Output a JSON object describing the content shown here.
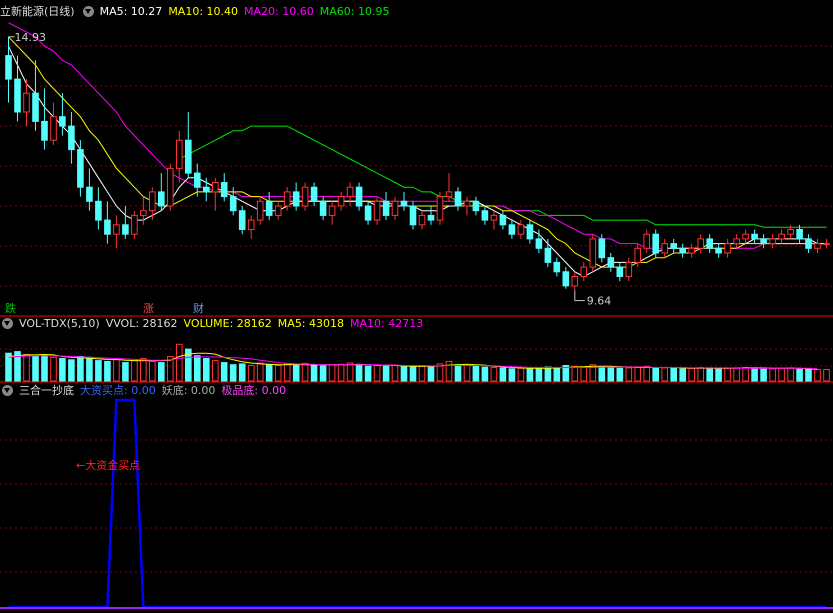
{
  "panel_main": {
    "stock_name": "立新能源",
    "period": "(日线)",
    "ma5_label": "MA5: 10.27",
    "ma10_label": "MA10: 10.40",
    "ma20_label": "MA20: 10.60",
    "ma60_label": "MA60: 10.95",
    "high_marker": "14.93",
    "low_marker": "9.64",
    "signals": [
      {
        "text": "跌",
        "color": "#00c000"
      },
      {
        "text": "涨",
        "color": "#ff4040"
      },
      {
        "text": "财",
        "color": "#6699ff"
      }
    ]
  },
  "panel_volume": {
    "indicator": "VOL-TDX(5,10)",
    "vvol_label": "VVOL: 28162",
    "volume_label": "VOLUME: 28162",
    "ma5_label": "MA5: 43018",
    "ma10_label": "MA10: 42713"
  },
  "panel_indicator": {
    "name": "三合一抄底",
    "buy_label": "大资买点: 0.00",
    "yao_label": "妖底: 0.00",
    "best_label": "极品底: 0.00",
    "annotation": "←大资金买点"
  },
  "colors": {
    "up": "#ff3232",
    "down": "#54fcfc",
    "ma5": "#ffffff",
    "ma10": "#ffff00",
    "ma20": "#ff00ff",
    "ma60": "#00e600",
    "signal_line": "#0000ff",
    "grid": "#8b0000"
  },
  "chart_data": [
    {
      "type": "candlestick",
      "title": "立新能源 (日线)",
      "ylim": [
        9.4,
        15.4
      ],
      "candles_ohlc": [
        [
          14.6,
          15.0,
          13.6,
          14.1
        ],
        [
          14.1,
          14.6,
          13.2,
          13.4
        ],
        [
          13.4,
          14.1,
          13.1,
          13.8
        ],
        [
          13.8,
          14.5,
          13.0,
          13.2
        ],
        [
          13.2,
          13.9,
          12.6,
          12.8
        ],
        [
          12.8,
          13.6,
          12.7,
          13.3
        ],
        [
          13.3,
          13.8,
          12.9,
          13.1
        ],
        [
          13.1,
          13.4,
          12.3,
          12.6
        ],
        [
          12.6,
          12.8,
          11.6,
          11.8
        ],
        [
          11.8,
          12.2,
          11.3,
          11.5
        ],
        [
          11.5,
          11.8,
          10.9,
          11.1
        ],
        [
          11.1,
          11.5,
          10.6,
          10.8
        ],
        [
          10.8,
          11.2,
          10.5,
          11.0
        ],
        [
          11.0,
          11.4,
          10.7,
          10.8
        ],
        [
          10.8,
          11.3,
          10.7,
          11.2
        ],
        [
          11.2,
          11.6,
          11.0,
          11.3
        ],
        [
          11.3,
          11.8,
          11.1,
          11.7
        ],
        [
          11.7,
          12.1,
          11.3,
          11.4
        ],
        [
          11.4,
          12.3,
          11.3,
          12.2
        ],
        [
          12.2,
          13.0,
          11.9,
          12.8
        ],
        [
          12.8,
          13.4,
          12.0,
          12.1
        ],
        [
          12.1,
          12.3,
          11.6,
          11.8
        ],
        [
          11.8,
          12.0,
          11.5,
          11.7
        ],
        [
          11.7,
          12.0,
          11.3,
          11.9
        ],
        [
          11.9,
          12.1,
          11.5,
          11.6
        ],
        [
          11.6,
          11.8,
          11.2,
          11.3
        ],
        [
          11.3,
          11.4,
          10.8,
          10.9
        ],
        [
          10.9,
          11.2,
          10.7,
          11.1
        ],
        [
          11.1,
          11.6,
          11.0,
          11.5
        ],
        [
          11.5,
          11.7,
          11.1,
          11.2
        ],
        [
          11.2,
          11.5,
          11.1,
          11.4
        ],
        [
          11.4,
          11.8,
          11.3,
          11.7
        ],
        [
          11.7,
          11.9,
          11.3,
          11.4
        ],
        [
          11.4,
          11.9,
          11.3,
          11.8
        ],
        [
          11.8,
          11.9,
          11.4,
          11.5
        ],
        [
          11.5,
          11.6,
          11.1,
          11.2
        ],
        [
          11.2,
          11.5,
          11.0,
          11.4
        ],
        [
          11.4,
          11.7,
          11.3,
          11.6
        ],
        [
          11.6,
          11.9,
          11.4,
          11.8
        ],
        [
          11.8,
          11.9,
          11.3,
          11.4
        ],
        [
          11.4,
          11.5,
          11.0,
          11.1
        ],
        [
          11.1,
          11.6,
          11.0,
          11.5
        ],
        [
          11.5,
          11.7,
          11.1,
          11.2
        ],
        [
          11.2,
          11.6,
          11.1,
          11.5
        ],
        [
          11.5,
          11.7,
          11.3,
          11.4
        ],
        [
          11.4,
          11.5,
          10.9,
          11.0
        ],
        [
          11.0,
          11.3,
          10.9,
          11.2
        ],
        [
          11.2,
          11.4,
          11.0,
          11.1
        ],
        [
          11.1,
          11.7,
          11.0,
          11.6
        ],
        [
          11.6,
          12.1,
          11.5,
          11.7
        ],
        [
          11.7,
          11.8,
          11.3,
          11.4
        ],
        [
          11.4,
          11.6,
          11.2,
          11.5
        ],
        [
          11.5,
          11.6,
          11.2,
          11.3
        ],
        [
          11.3,
          11.4,
          11.0,
          11.1
        ],
        [
          11.1,
          11.3,
          10.9,
          11.2
        ],
        [
          11.2,
          11.3,
          10.9,
          11.0
        ],
        [
          11.0,
          11.1,
          10.7,
          10.8
        ],
        [
          10.8,
          11.1,
          10.7,
          11.0
        ],
        [
          11.0,
          11.1,
          10.6,
          10.7
        ],
        [
          10.7,
          10.9,
          10.4,
          10.5
        ],
        [
          10.5,
          10.7,
          10.1,
          10.2
        ],
        [
          10.2,
          10.3,
          9.9,
          10.0
        ],
        [
          10.0,
          10.1,
          9.64,
          9.7
        ],
        [
          9.7,
          10.0,
          9.6,
          9.9
        ],
        [
          9.9,
          10.2,
          9.8,
          10.1
        ],
        [
          10.1,
          10.8,
          10.0,
          10.7
        ],
        [
          10.7,
          10.8,
          10.2,
          10.3
        ],
        [
          10.3,
          10.4,
          10.0,
          10.1
        ],
        [
          10.1,
          10.2,
          9.8,
          9.9
        ],
        [
          9.9,
          10.3,
          9.8,
          10.2
        ],
        [
          10.2,
          10.6,
          10.1,
          10.5
        ],
        [
          10.5,
          10.9,
          10.4,
          10.8
        ],
        [
          10.8,
          10.9,
          10.3,
          10.4
        ],
        [
          10.4,
          10.7,
          10.3,
          10.6
        ],
        [
          10.6,
          10.7,
          10.4,
          10.5
        ],
        [
          10.5,
          10.6,
          10.3,
          10.4
        ],
        [
          10.4,
          10.6,
          10.3,
          10.5
        ],
        [
          10.5,
          10.8,
          10.4,
          10.7
        ],
        [
          10.7,
          10.8,
          10.4,
          10.5
        ],
        [
          10.5,
          10.6,
          10.3,
          10.4
        ],
        [
          10.4,
          10.7,
          10.3,
          10.6
        ],
        [
          10.6,
          10.8,
          10.5,
          10.7
        ],
        [
          10.7,
          10.9,
          10.6,
          10.8
        ],
        [
          10.8,
          10.9,
          10.6,
          10.7
        ],
        [
          10.7,
          10.8,
          10.5,
          10.6
        ],
        [
          10.6,
          10.8,
          10.5,
          10.7
        ],
        [
          10.7,
          10.9,
          10.6,
          10.8
        ],
        [
          10.8,
          11.0,
          10.7,
          10.9
        ],
        [
          10.9,
          11.0,
          10.6,
          10.7
        ],
        [
          10.7,
          10.8,
          10.4,
          10.5
        ],
        [
          10.5,
          10.7,
          10.4,
          10.6
        ],
        [
          10.6,
          10.7,
          10.5,
          10.6
        ]
      ],
      "ma5_series": [
        14.8,
        14.4,
        14.0,
        13.8,
        13.5,
        13.3,
        13.1,
        12.9,
        12.6,
        12.3,
        12.0,
        11.7,
        11.4,
        11.2,
        11.1,
        11.1,
        11.2,
        11.3,
        11.5,
        11.8,
        12.0,
        12.0,
        11.9,
        11.8,
        11.7,
        11.6,
        11.5,
        11.4,
        11.3,
        11.3,
        11.3,
        11.4,
        11.5,
        11.5,
        11.5,
        11.5,
        11.5,
        11.5,
        11.5,
        11.5,
        11.5,
        11.4,
        11.4,
        11.4,
        11.4,
        11.4,
        11.3,
        11.3,
        11.3,
        11.4,
        11.4,
        11.5,
        11.5,
        11.4,
        11.3,
        11.2,
        11.1,
        11.0,
        10.9,
        10.8,
        10.6,
        10.4,
        10.2,
        10.0,
        9.9,
        10.0,
        10.1,
        10.2,
        10.2,
        10.2,
        10.2,
        10.3,
        10.4,
        10.5,
        10.5,
        10.5,
        10.5,
        10.5,
        10.6,
        10.6,
        10.6,
        10.6,
        10.6,
        10.7,
        10.7,
        10.7,
        10.7,
        10.7,
        10.7,
        10.7,
        10.6,
        10.6
      ],
      "ma10_series": [
        15.0,
        14.8,
        14.6,
        14.4,
        14.1,
        13.9,
        13.7,
        13.5,
        13.3,
        13.0,
        12.8,
        12.5,
        12.2,
        12.0,
        11.8,
        11.6,
        11.5,
        11.4,
        11.4,
        11.5,
        11.6,
        11.7,
        11.7,
        11.7,
        11.7,
        11.7,
        11.7,
        11.6,
        11.6,
        11.5,
        11.5,
        11.5,
        11.5,
        11.5,
        11.5,
        11.5,
        11.5,
        11.5,
        11.5,
        11.5,
        11.5,
        11.5,
        11.5,
        11.4,
        11.4,
        11.4,
        11.4,
        11.4,
        11.4,
        11.4,
        11.4,
        11.4,
        11.4,
        11.4,
        11.4,
        11.3,
        11.3,
        11.2,
        11.1,
        11.0,
        10.9,
        10.7,
        10.6,
        10.4,
        10.3,
        10.2,
        10.1,
        10.1,
        10.1,
        10.1,
        10.2,
        10.2,
        10.3,
        10.3,
        10.4,
        10.4,
        10.4,
        10.5,
        10.5,
        10.5,
        10.5,
        10.5,
        10.6,
        10.6,
        10.6,
        10.6,
        10.6,
        10.6,
        10.6,
        10.6,
        10.6,
        10.6
      ],
      "ma20_series": [
        15.3,
        15.2,
        15.1,
        15.0,
        14.8,
        14.7,
        14.5,
        14.4,
        14.2,
        14.0,
        13.8,
        13.6,
        13.4,
        13.1,
        12.9,
        12.7,
        12.5,
        12.3,
        12.1,
        12.0,
        11.9,
        11.8,
        11.8,
        11.7,
        11.7,
        11.7,
        11.6,
        11.6,
        11.6,
        11.6,
        11.6,
        11.6,
        11.6,
        11.6,
        11.6,
        11.6,
        11.6,
        11.6,
        11.6,
        11.6,
        11.6,
        11.6,
        11.5,
        11.5,
        11.5,
        11.5,
        11.5,
        11.5,
        11.5,
        11.5,
        11.5,
        11.4,
        11.4,
        11.4,
        11.4,
        11.4,
        11.3,
        11.3,
        11.3,
        11.2,
        11.2,
        11.1,
        11.0,
        10.9,
        10.8,
        10.8,
        10.7,
        10.7,
        10.6,
        10.6,
        10.6,
        10.5,
        10.5,
        10.5,
        10.5,
        10.5,
        10.5,
        10.5,
        10.5,
        10.5,
        10.5,
        10.5,
        10.5,
        10.5,
        10.6,
        10.6,
        10.6,
        10.6,
        10.6,
        10.6,
        10.6,
        10.6
      ],
      "ma60_series": [
        null,
        null,
        null,
        null,
        null,
        null,
        null,
        null,
        null,
        null,
        null,
        null,
        null,
        null,
        null,
        null,
        null,
        null,
        null,
        12.4,
        12.5,
        12.6,
        12.7,
        12.8,
        12.9,
        13.0,
        13.0,
        13.1,
        13.1,
        13.1,
        13.1,
        13.1,
        13.0,
        12.9,
        12.8,
        12.7,
        12.6,
        12.5,
        12.4,
        12.3,
        12.2,
        12.1,
        12.0,
        11.9,
        11.8,
        11.8,
        11.7,
        11.7,
        11.6,
        11.6,
        11.5,
        11.5,
        11.5,
        11.4,
        11.4,
        11.4,
        11.3,
        11.3,
        11.3,
        11.3,
        11.2,
        11.2,
        11.2,
        11.2,
        11.2,
        11.1,
        11.1,
        11.1,
        11.1,
        11.1,
        11.1,
        11.1,
        11.0,
        11.0,
        11.0,
        11.0,
        11.0,
        11.0,
        11.0,
        11.0,
        11.0,
        11.0,
        11.0,
        11.0,
        10.95,
        10.95,
        10.95,
        10.95,
        10.95,
        10.95,
        10.95,
        10.95
      ]
    },
    {
      "type": "bar",
      "title": "VOL-TDX(5,10)",
      "ylim": [
        0,
        120000
      ],
      "volumes": [
        68000,
        72000,
        65000,
        60000,
        64000,
        58000,
        55000,
        52000,
        60000,
        58000,
        50000,
        48000,
        52000,
        45000,
        50000,
        55000,
        48000,
        45000,
        60000,
        90000,
        78000,
        62000,
        55000,
        50000,
        45000,
        40000,
        42000,
        38000,
        44000,
        40000,
        38000,
        42000,
        40000,
        43000,
        39000,
        37000,
        40000,
        41000,
        44000,
        40000,
        36000,
        38000,
        37000,
        39000,
        36000,
        34000,
        36000,
        35000,
        42000,
        48000,
        40000,
        38000,
        36000,
        34000,
        33000,
        32000,
        30000,
        31000,
        30000,
        32000,
        34000,
        33000,
        38000,
        36000,
        34000,
        40000,
        35000,
        33000,
        31000,
        32000,
        34000,
        36000,
        33000,
        32000,
        31000,
        30000,
        31000,
        33000,
        32000,
        30000,
        31000,
        32000,
        33000,
        32000,
        31000,
        30000,
        31000,
        32000,
        30000,
        29000,
        28162,
        28162
      ],
      "ma5_series": [
        60000,
        62000,
        64000,
        64000,
        65000,
        64000,
        60000,
        58000,
        57000,
        56000,
        54000,
        53000,
        53000,
        51000,
        50000,
        50000,
        50000,
        50000,
        51000,
        60000,
        66000,
        68000,
        68000,
        66000,
        58000,
        52000,
        47000,
        44000,
        42000,
        41000,
        40000,
        40000,
        41000,
        40000,
        40000,
        40000,
        40000,
        40000,
        40000,
        41000,
        40000,
        39000,
        39000,
        38000,
        37000,
        36000,
        36000,
        36000,
        37000,
        39000,
        40000,
        41000,
        40000,
        39000,
        36000,
        35000,
        33000,
        32000,
        31000,
        31000,
        31000,
        32000,
        33000,
        34000,
        35000,
        36000,
        36000,
        36000,
        35000,
        34000,
        33000,
        33000,
        33000,
        33000,
        33000,
        32000,
        31000,
        31000,
        31000,
        31000,
        31000,
        31000,
        32000,
        32000,
        32000,
        31000,
        31000,
        31000,
        31000,
        30000,
        29000,
        43018
      ],
      "ma10_series": [
        58000,
        60000,
        61000,
        62000,
        62000,
        62000,
        61000,
        60000,
        59000,
        58000,
        57000,
        56000,
        55000,
        54000,
        53000,
        52000,
        51000,
        51000,
        52000,
        55000,
        58000,
        59000,
        59000,
        59000,
        58000,
        57000,
        56000,
        54000,
        51000,
        48000,
        45000,
        43000,
        42000,
        41000,
        41000,
        40000,
        40000,
        40000,
        40000,
        40000,
        40000,
        40000,
        39000,
        39000,
        38000,
        38000,
        38000,
        37000,
        37000,
        38000,
        38000,
        38000,
        38000,
        38000,
        37000,
        36000,
        35000,
        34000,
        33000,
        33000,
        33000,
        33000,
        33000,
        33000,
        33000,
        33000,
        34000,
        34000,
        34000,
        34000,
        34000,
        34000,
        33000,
        33000,
        33000,
        33000,
        32000,
        32000,
        32000,
        32000,
        32000,
        31000,
        31000,
        31000,
        31000,
        31000,
        31000,
        31000,
        31000,
        31000,
        30000,
        42713
      ]
    },
    {
      "type": "line",
      "title": "三合一抄底",
      "ylim": [
        0,
        1
      ],
      "signal_series": [
        0,
        0,
        0,
        0,
        0,
        0,
        0,
        0,
        0,
        0,
        0,
        0,
        1,
        1,
        1,
        0,
        0,
        0,
        0,
        0,
        0,
        0,
        0,
        0,
        0,
        0,
        0,
        0,
        0,
        0,
        0,
        0,
        0,
        0,
        0,
        0,
        0,
        0,
        0,
        0,
        0,
        0,
        0,
        0,
        0,
        0,
        0,
        0,
        0,
        0,
        0,
        0,
        0,
        0,
        0,
        0,
        0,
        0,
        0,
        0,
        0,
        0,
        0,
        0,
        0,
        0,
        0,
        0,
        0,
        0,
        0,
        0,
        0,
        0,
        0,
        0,
        0,
        0,
        0,
        0,
        0,
        0,
        0,
        0,
        0,
        0,
        0,
        0,
        0,
        0,
        0,
        0
      ]
    }
  ]
}
